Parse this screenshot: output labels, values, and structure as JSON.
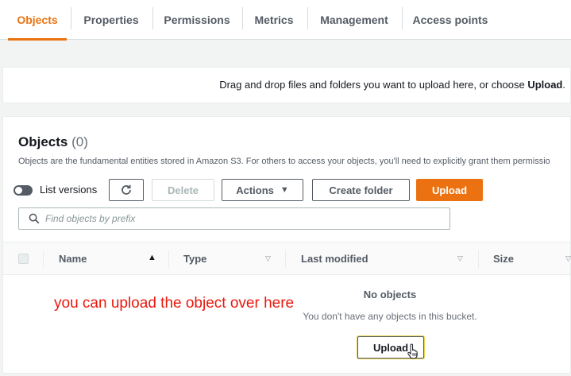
{
  "tabs": [
    {
      "label": "Objects",
      "active": true
    },
    {
      "label": "Properties",
      "active": false
    },
    {
      "label": "Permissions",
      "active": false
    },
    {
      "label": "Metrics",
      "active": false
    },
    {
      "label": "Management",
      "active": false
    },
    {
      "label": "Access points",
      "active": false
    }
  ],
  "dropzone": {
    "text": "Drag and drop files and folders you want to upload here, or choose",
    "link": "Upload",
    "suffix": "."
  },
  "objects_panel": {
    "title": "Objects",
    "count": "(0)",
    "description": "Objects are the fundamental entities stored in Amazon S3. For others to access your objects, you'll need to explicitly grant them permissio",
    "toggle_label": "List versions",
    "toggle_on": false,
    "buttons": {
      "refresh_icon": "refresh-icon",
      "delete": "Delete",
      "actions": "Actions",
      "create_folder": "Create folder",
      "upload": "Upload"
    },
    "search_placeholder": "Find objects by prefix"
  },
  "table": {
    "columns": [
      "Name",
      "Type",
      "Last modified",
      "Size"
    ],
    "empty_title": "No objects",
    "empty_description": "You don't have any objects in this bucket.",
    "empty_upload_button": "Upload"
  },
  "annotation": "you can upload the object over here",
  "colors": {
    "accent": "#ec7211",
    "annotation": "#e8190e"
  }
}
